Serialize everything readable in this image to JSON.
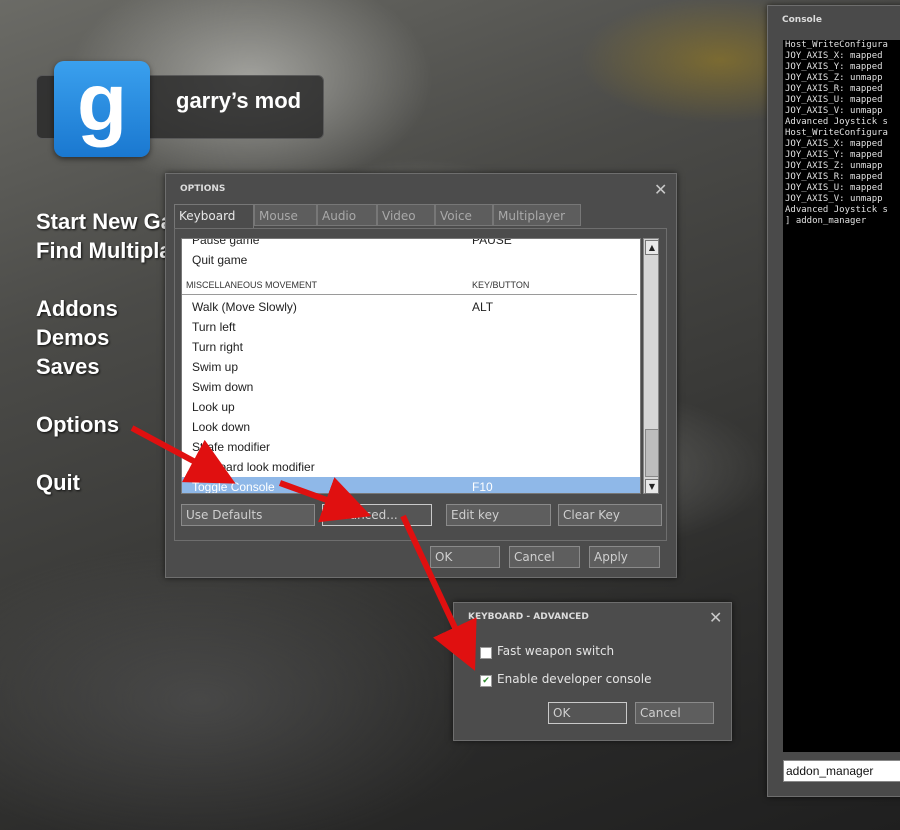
{
  "logo": {
    "glyph": "g",
    "title": "garry’s mod"
  },
  "main_menu": [
    {
      "label": "Start New Ga"
    },
    {
      "label": "Find Multipla"
    },
    {
      "label": "Addons"
    },
    {
      "label": "Demos"
    },
    {
      "label": "Saves"
    },
    {
      "label": "Options"
    },
    {
      "label": "Quit"
    }
  ],
  "options": {
    "title": "OPTIONS",
    "tabs": [
      "Keyboard",
      "Mouse",
      "Audio",
      "Video",
      "Voice",
      "Multiplayer"
    ],
    "active_tab": "Keyboard",
    "rows": [
      {
        "action": "Pause game",
        "key": "PAUSE"
      },
      {
        "action": "Quit game",
        "key": ""
      },
      {
        "action": "MISCELLANEOUS MOVEMENT",
        "key": "KEY/BUTTON"
      },
      {
        "action": "Walk (Move Slowly)",
        "key": "ALT"
      },
      {
        "action": "Turn left",
        "key": ""
      },
      {
        "action": "Turn right",
        "key": ""
      },
      {
        "action": "Swim up",
        "key": ""
      },
      {
        "action": "Swim down",
        "key": ""
      },
      {
        "action": "Look up",
        "key": ""
      },
      {
        "action": "Look down",
        "key": ""
      },
      {
        "action": "Strafe modifier",
        "key": ""
      },
      {
        "action": "Keyboard look modifier",
        "key": ""
      },
      {
        "action": "Toggle Console",
        "key": "F10"
      }
    ],
    "buttons": {
      "use_defaults": "Use Defaults",
      "advanced": "Advanced...",
      "edit_key": "Edit key",
      "clear_key": "Clear Key",
      "ok": "OK",
      "cancel": "Cancel",
      "apply": "Apply"
    }
  },
  "advanced": {
    "title": "KEYBOARD - ADVANCED",
    "fast_weapon_switch": {
      "label": "Fast weapon switch",
      "checked": false
    },
    "developer_console": {
      "label": "Enable developer console",
      "checked": true
    },
    "ok": "OK",
    "cancel": "Cancel"
  },
  "console": {
    "title": "Console",
    "lines": [
      "Host_WriteConfigura",
      "JOY_AXIS_X:  mapped",
      "JOY_AXIS_Y:  mapped",
      "JOY_AXIS_Z:  unmapp",
      "JOY_AXIS_R:  mapped",
      "JOY_AXIS_U:  mapped",
      "JOY_AXIS_V:  unmapp",
      "Advanced Joystick s",
      "Host_WriteConfigura",
      "JOY_AXIS_X:  mapped",
      "JOY_AXIS_Y:  mapped",
      "JOY_AXIS_Z:  unmapp",
      "JOY_AXIS_R:  mapped",
      "JOY_AXIS_U:  mapped",
      "JOY_AXIS_V:  unmapp",
      "Advanced Joystick s",
      "] addon_manager"
    ],
    "input_value": "addon_manager"
  },
  "colors": {
    "arrow": "#e01010",
    "selection": "#8fb8e8",
    "logo_blue": "#1a78d0"
  },
  "icons": [
    "close-icon",
    "checkmark-icon",
    "scroll-up-icon",
    "scroll-down-icon",
    "arrow-annotation"
  ]
}
